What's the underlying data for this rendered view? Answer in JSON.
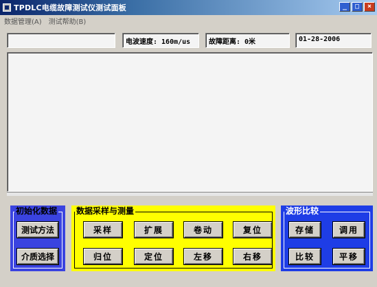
{
  "window": {
    "title": "TPDLC电缆故障测试仪测试面板",
    "min_label": "_",
    "max_label": "□",
    "close_label": "×"
  },
  "menu": [
    {
      "label": "数据管理(A)"
    },
    {
      "label": "测试帮助(B)"
    }
  ],
  "info": {
    "blank": "",
    "speed": "电波速度: 160m/us",
    "distance": "故障距离: 0米",
    "date": "01-28-2006"
  },
  "groups": {
    "init": {
      "title": "初始化数据",
      "buttons": [
        "测试方法",
        "介质选择"
      ]
    },
    "sampling": {
      "title": "数据采样与测量",
      "buttons": [
        "采样",
        "扩展",
        "卷动",
        "复位",
        "归位",
        "定位",
        "左移",
        "右移"
      ]
    },
    "compare": {
      "title": "波形比较",
      "buttons": [
        "存储",
        "调用",
        "比较",
        "平移"
      ]
    }
  },
  "colors": {
    "title_start": "#0a246a",
    "group_blue": "#3a43e0",
    "group_yellow": "#ffff00",
    "group_blue2": "#1e3de6"
  }
}
